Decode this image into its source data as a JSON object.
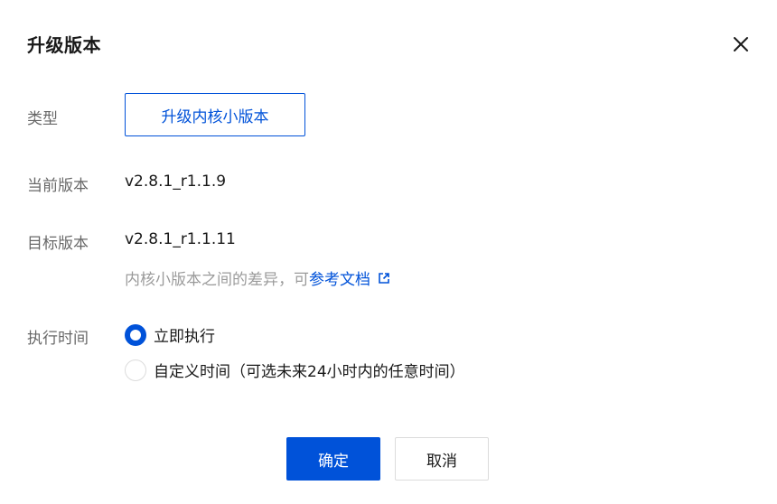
{
  "dialog": {
    "title": "升级版本"
  },
  "form": {
    "type_label": "类型",
    "type_value": "升级内核小版本",
    "current_label": "当前版本",
    "current_value": "v2.8.1_r1.1.9",
    "target_label": "目标版本",
    "target_value": "v2.8.1_r1.1.11",
    "hint_text": "内核小版本之间的差异，可",
    "hint_link": "参考文档",
    "time_label": "执行时间",
    "time_options": [
      {
        "label": "立即执行",
        "selected": true
      },
      {
        "label": "自定义时间（可选未来24小时内的任意时间）",
        "selected": false
      }
    ]
  },
  "footer": {
    "confirm_label": "确定",
    "cancel_label": "取消"
  },
  "colors": {
    "primary": "#0052d9",
    "border": "#dcdcdc"
  },
  "icons": {
    "close": "close-icon",
    "external_link": "external-link-icon"
  }
}
